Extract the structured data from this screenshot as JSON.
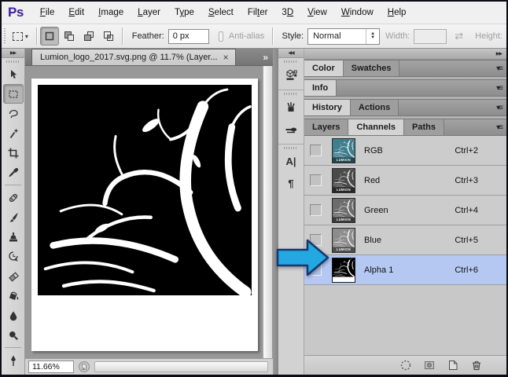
{
  "window": {
    "logo": "Ps"
  },
  "menubar": {
    "items": [
      {
        "label": "File",
        "u": 0
      },
      {
        "label": "Edit",
        "u": 0
      },
      {
        "label": "Image",
        "u": 0
      },
      {
        "label": "Layer",
        "u": 0
      },
      {
        "label": "Type",
        "u": 1
      },
      {
        "label": "Select",
        "u": 0
      },
      {
        "label": "Filter",
        "u": 3
      },
      {
        "label": "3D",
        "u": 1
      },
      {
        "label": "View",
        "u": 0
      },
      {
        "label": "Window",
        "u": 0
      },
      {
        "label": "Help",
        "u": 0
      }
    ]
  },
  "options_bar": {
    "selection_modes": [
      {
        "name": "new-selection",
        "active": true
      },
      {
        "name": "add-to-selection",
        "active": false
      },
      {
        "name": "subtract-from-selection",
        "active": false
      },
      {
        "name": "intersect-selection",
        "active": false
      }
    ],
    "feather_label": "Feather:",
    "feather_value": "0 px",
    "anti_alias_label": "Anti-alias",
    "style_label": "Style:",
    "style_value": "Normal",
    "width_label": "Width:",
    "width_value": "",
    "height_label": "Height:"
  },
  "toolbar": {
    "tools": [
      {
        "name": "move-tool"
      },
      {
        "name": "rectangular-marquee-tool",
        "selected": true
      },
      {
        "name": "lasso-tool"
      },
      {
        "name": "magic-wand-tool"
      },
      {
        "name": "crop-tool"
      },
      {
        "name": "eyedropper-tool"
      },
      {
        "name": "divider"
      },
      {
        "name": "healing-brush-tool"
      },
      {
        "name": "brush-tool"
      },
      {
        "name": "clone-stamp-tool"
      },
      {
        "name": "history-brush-tool"
      },
      {
        "name": "eraser-tool"
      },
      {
        "name": "paint-bucket-tool"
      },
      {
        "name": "blur-tool"
      },
      {
        "name": "dodge-tool"
      },
      {
        "name": "divider"
      },
      {
        "name": "pen-tool"
      }
    ]
  },
  "document": {
    "tab_title": "Lumion_logo_2017.svg.png @ 11.7% (Layer...",
    "zoom_level": "11.66%"
  },
  "icon_dock": {
    "groups": [
      [
        "3d-panel"
      ],
      [
        "brush-presets-panel",
        "clone-source-panel"
      ],
      [
        "character-panel",
        "paragraph-panel"
      ]
    ]
  },
  "panels": {
    "groups": [
      {
        "tabs": [
          {
            "label": "Color",
            "active": true
          },
          {
            "label": "Swatches",
            "active": false
          }
        ]
      },
      {
        "tabs": [
          {
            "label": "Info",
            "active": true
          }
        ]
      },
      {
        "tabs": [
          {
            "label": "History",
            "active": true
          },
          {
            "label": "Actions",
            "active": false
          }
        ]
      },
      {
        "tabs": [
          {
            "label": "Layers",
            "active": false
          },
          {
            "label": "Channels",
            "active": true
          },
          {
            "label": "Paths",
            "active": false
          }
        ]
      }
    ],
    "channels": {
      "thumb_label": "LUMION",
      "rows": [
        {
          "name": "RGB",
          "shortcut": "Ctrl+2",
          "thumb_bg": "#3f7e8e",
          "thumb_kind": "logo",
          "selected": false
        },
        {
          "name": "Red",
          "shortcut": "Ctrl+3",
          "thumb_bg": "#4a4a4a",
          "thumb_kind": "logo",
          "selected": false
        },
        {
          "name": "Green",
          "shortcut": "Ctrl+4",
          "thumb_bg": "#6c6c6c",
          "thumb_kind": "logo",
          "selected": false
        },
        {
          "name": "Blue",
          "shortcut": "Ctrl+5",
          "thumb_bg": "#8c8c8c",
          "thumb_kind": "logo",
          "selected": false
        },
        {
          "name": "Alpha 1",
          "shortcut": "Ctrl+6",
          "thumb_bg": "#000000",
          "thumb_kind": "alpha",
          "selected": true
        }
      ]
    },
    "footer_icons": [
      "load-channel-as-selection",
      "save-selection-as-channel",
      "new-channel",
      "delete-channel"
    ]
  },
  "annotation": {
    "arrow_color": "#23a8e2",
    "arrow_outline": "#16386e"
  }
}
